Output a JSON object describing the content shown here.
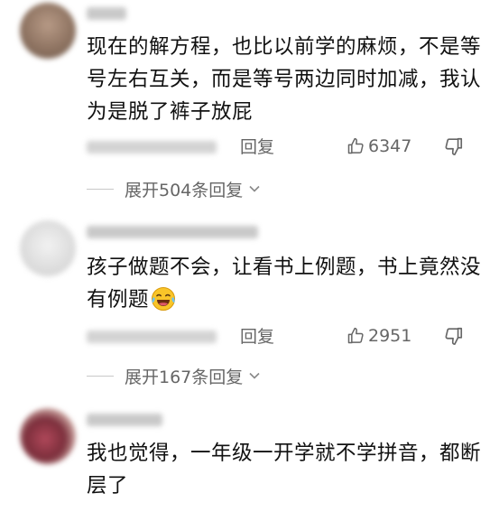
{
  "comments": [
    {
      "text": "现在的解方程，也比以前学的麻烦，不是等号左右互关，而是等号两边同时加减，我认为是脱了裤子放屁",
      "reply_label": "回复",
      "likes": "6347",
      "expand_label": "展开504条回复"
    },
    {
      "text": "孩子做题不会，让看书上例题，书上竟然没有例题",
      "reply_label": "回复",
      "likes": "2951",
      "expand_label": "展开167条回复"
    },
    {
      "text": "我也觉得，一年级一开学就不学拼音，都断层了"
    }
  ],
  "icons": {
    "like": "thumbs-up-icon",
    "dislike": "thumbs-down-icon",
    "expand": "chevron-down-icon",
    "emoji": "laughing-tears-emoji-icon"
  },
  "colors": {
    "text": "#111111",
    "secondary": "#666666",
    "background": "#ffffff"
  }
}
